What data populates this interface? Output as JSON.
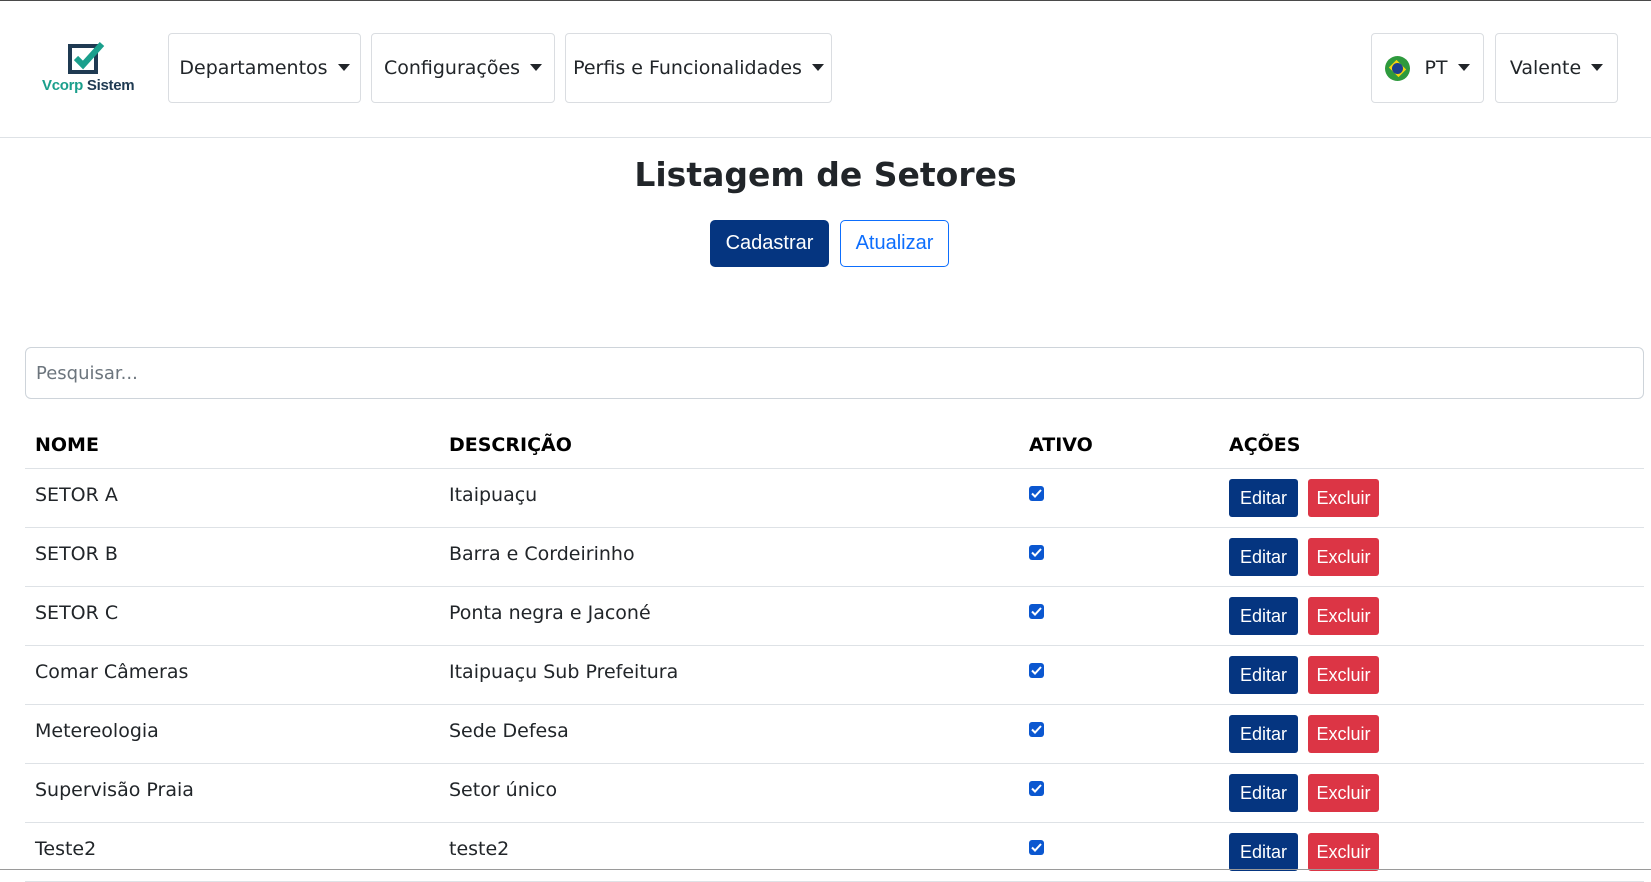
{
  "brand": {
    "part1": "Vcorp",
    "part2": "Sistem",
    "accent": "#1a9f8c",
    "dark": "#1f3a52"
  },
  "nav": {
    "items": [
      {
        "label": "Departamentos"
      },
      {
        "label": "Configurações"
      },
      {
        "label": "Perfis e Funcionalidades"
      }
    ],
    "language": "PT",
    "user": "Valente"
  },
  "page": {
    "title": "Listagem de Setores",
    "register_label": "Cadastrar",
    "refresh_label": "Atualizar"
  },
  "search": {
    "placeholder": "Pesquisar...",
    "value": ""
  },
  "table": {
    "headers": [
      "NOME",
      "DESCRIÇÃO",
      "ATIVO",
      "AÇÕES"
    ],
    "edit_label": "Editar",
    "delete_label": "Excluir",
    "rows": [
      {
        "name": "SETOR A",
        "description": "Itaipuaçu",
        "active": true
      },
      {
        "name": "SETOR B",
        "description": "Barra e Cordeirinho",
        "active": true
      },
      {
        "name": "SETOR C",
        "description": "Ponta negra e Jaconé",
        "active": true
      },
      {
        "name": "Comar Câmeras",
        "description": "Itaipuaçu Sub Prefeitura",
        "active": true
      },
      {
        "name": "Metereologia",
        "description": "Sede Defesa",
        "active": true
      },
      {
        "name": "Supervisão Praia",
        "description": "Setor único",
        "active": true
      },
      {
        "name": "Teste2",
        "description": "teste2",
        "active": true
      }
    ]
  },
  "colors": {
    "primary": "#053580",
    "danger": "#dc3545",
    "outline": "#0d6efd",
    "checkbox": "#0b57d0"
  }
}
